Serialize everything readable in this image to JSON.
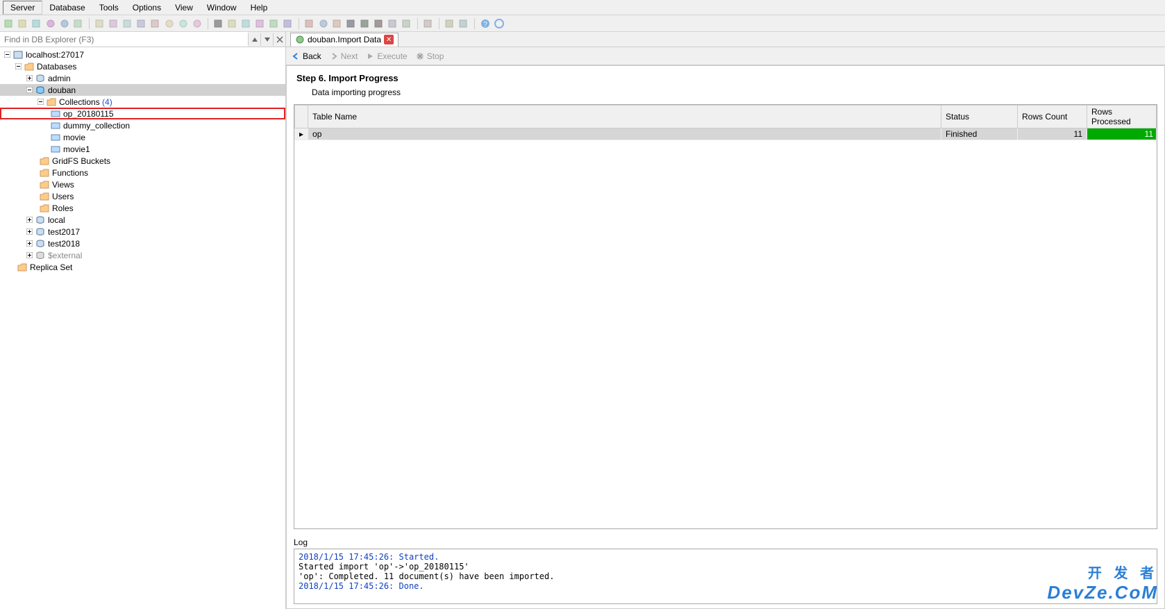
{
  "menu": [
    "Server",
    "Database",
    "Tools",
    "Options",
    "View",
    "Window",
    "Help"
  ],
  "search": {
    "placeholder": "Find in DB Explorer (F3)"
  },
  "tree": {
    "root": "localhost:27017",
    "databases_label": "Databases",
    "dbs": {
      "admin": "admin",
      "douban": "douban",
      "local": "local",
      "test2017": "test2017",
      "test2018": "test2018",
      "external": "$external"
    },
    "collections_label": "Collections",
    "collections_count": "(4)",
    "collections": [
      "op_20180115",
      "dummy_collection",
      "movie",
      "movie1"
    ],
    "gridfs": "GridFS Buckets",
    "functions": "Functions",
    "views": "Views",
    "users": "Users",
    "roles": "Roles",
    "replica": "Replica Set"
  },
  "tab": {
    "title": "douban.Import Data"
  },
  "nav": {
    "back": "Back",
    "next": "Next",
    "execute": "Execute",
    "stop": "Stop"
  },
  "wizard": {
    "title": "Step 6. Import Progress",
    "desc": "Data importing progress"
  },
  "table": {
    "headers": {
      "name": "Table Name",
      "status": "Status",
      "rows": "Rows Count",
      "processed": "Rows Processed"
    },
    "rows": [
      {
        "name": "op",
        "status": "Finished",
        "rows": "11",
        "processed": "11"
      }
    ]
  },
  "log": {
    "label": "Log",
    "lines": [
      "2018/1/15 17:45:26: Started.",
      "Started import 'op'->'op_20180115'",
      "'op': Completed. 11 document(s) have been imported.",
      "2018/1/15 17:45:26: Done."
    ]
  },
  "watermark": {
    "top": "开 发 者",
    "bot": "DevZe.CoM"
  }
}
